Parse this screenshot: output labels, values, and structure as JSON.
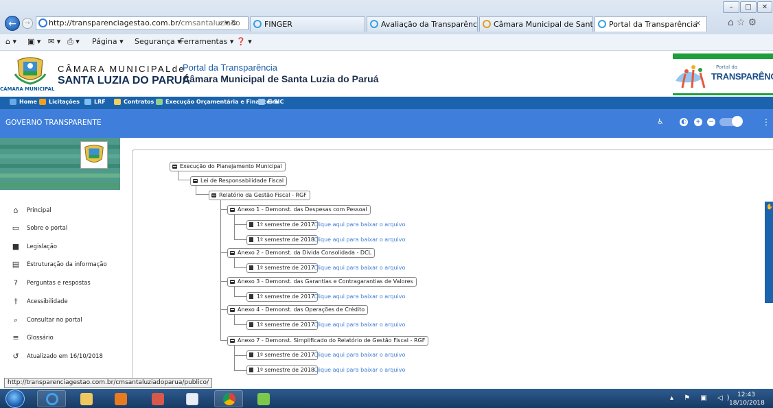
{
  "browser": {
    "address": "http://transparenciagestao.com.br/",
    "address_dim": "cmsantaluziado",
    "address_tools": "⌕ ▾ ↻",
    "tabs": [
      {
        "label": "FINGER"
      },
      {
        "label": "Avaliação da Transparência do..."
      },
      {
        "label": "Câmara Municipal de Santa Lu..."
      },
      {
        "label": "Portal da Transparência"
      }
    ],
    "tab_close": "×",
    "right_icons": "⌂☆⚙",
    "window_buttons": {
      "minimize": "–",
      "restore": "□",
      "close": "✕"
    },
    "commands": {
      "home": "⌂ ▾",
      "feeds": "▣ ▾",
      "mail": "✉ ▾",
      "print": "⎙ ▾",
      "page": "Página ▾",
      "security": "Segurança ▾",
      "tools": "Ferramentas ▾",
      "help": "❓ ▾"
    }
  },
  "site": {
    "logo_sub": "CÂMARA MUNICIPAL",
    "camara_top": "CÂMARA MUNICIPALde",
    "camara_bottom": "SANTA LUZIA DO PARUÁ",
    "portal_title": "Portal da Transparência",
    "portal_subtitle": "Câmara Municipal de Santa Luzia do Paruá",
    "pt_logo_small": "Portal da",
    "pt_logo_big": "TRANSPARÊNCIA"
  },
  "menu": {
    "items": [
      {
        "label": "Home",
        "color": "#6aa8e8"
      },
      {
        "label": "Licitações",
        "color": "#f0a020"
      },
      {
        "label": "LRF",
        "color": "#7cc0f0"
      },
      {
        "label": "Contratos",
        "color": "#f0d060"
      },
      {
        "label": "Execução Orçamentária e Financeira",
        "color": "#8fd08f"
      },
      {
        "label": "E-SIC",
        "color": "#9ec9f0"
      }
    ]
  },
  "govbar": {
    "title": "GOVERNO TRANSPARENTE",
    "icons": {
      "accessibility": "♿",
      "contrast": "◐",
      "zoom_in": "+",
      "zoom_out": "−",
      "more": "⋮"
    }
  },
  "sidebar": {
    "items": [
      {
        "label": "Principal",
        "icon": "⌂"
      },
      {
        "label": "Sobre o portal",
        "icon": "▭"
      },
      {
        "label": "Legislação",
        "icon": "■"
      },
      {
        "label": "Estruturação da informação",
        "icon": "▤"
      },
      {
        "label": "Perguntas e respostas",
        "icon": "?"
      },
      {
        "label": "Acessibilidade",
        "icon": "†"
      },
      {
        "label": "Consultar no portal",
        "icon": "⌕"
      },
      {
        "label": "Glossário",
        "icon": "≡"
      },
      {
        "label": "Atualizado em 16/10/2018",
        "icon": "↺"
      }
    ]
  },
  "tree": {
    "root": "Execução do Planejamento Municipal",
    "level1": "Lei de Responsabilidade Fiscal",
    "level2": "Relatório da Gestão Fiscal - RGF",
    "link_text": "Clique aqui para baixar o arquivo",
    "annexes": [
      {
        "label": "Anexo 1 - Demonst. das Despesas com Pessoal",
        "files": [
          "1º semestre de 2017",
          "1º semestre de 2018"
        ]
      },
      {
        "label": "Anexo 2 - Demonst. da Dívida Consolidada - DCL",
        "files": [
          "1º semestre de 2017"
        ]
      },
      {
        "label": "Anexo 3 - Demonst. das Garantias e Contragarantias de Valores",
        "files": [
          "1º semestre de 2017"
        ]
      },
      {
        "label": "Anexo 4 - Demonst. das Operações de Crédito",
        "files": [
          "1º semestre de 2017"
        ]
      },
      {
        "label": "Anexo 7 - Demonst. Simplificado do Relatório de Gestão Fiscal - RGF",
        "files": [
          "1º semestre de 2017",
          "1º semestre de 2018"
        ]
      }
    ]
  },
  "status_url": "http://transparenciagestao.com.br/cmsantaluziadoparua/publico/",
  "taskbar": {
    "time": "12:43",
    "date": "18/10/2018",
    "tray": "▴ ⚑ ▣ ◁)"
  }
}
